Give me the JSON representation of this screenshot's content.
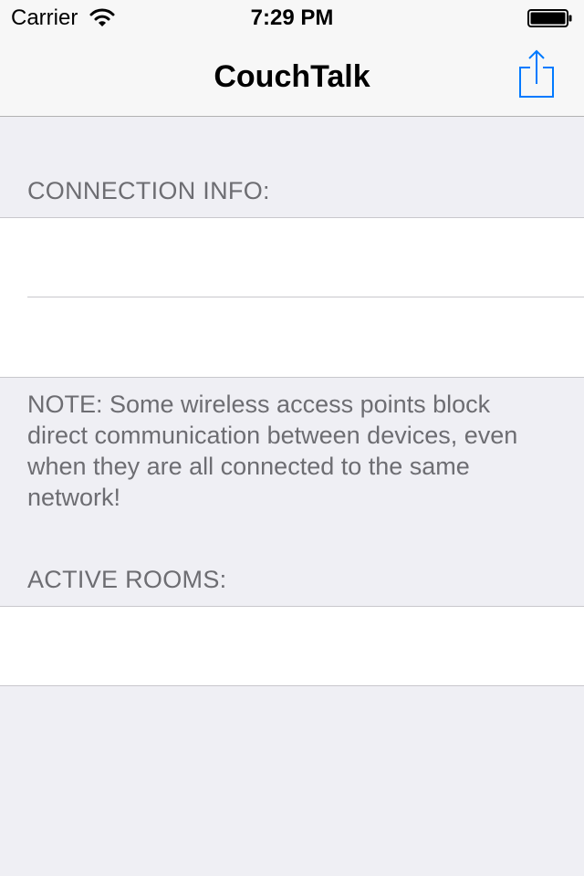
{
  "status_bar": {
    "carrier": "Carrier",
    "time": "7:29 PM",
    "wifi_icon": "wifi-icon",
    "battery_icon": "battery-icon"
  },
  "nav": {
    "title": "CouchTalk",
    "share_icon": "share-icon",
    "accent_color": "#007aff"
  },
  "connection_info": {
    "header": "CONNECTION INFO:",
    "rows": [
      "",
      ""
    ]
  },
  "note": "NOTE: Some wireless access points block direct communication between devices, even when they are all connected to the same network!",
  "active_rooms": {
    "header": "ACTIVE ROOMS:",
    "rows": [
      ""
    ]
  },
  "colors": {
    "background": "#efeff4",
    "section_text": "#6d6d72",
    "separator": "#c8c7cc"
  }
}
